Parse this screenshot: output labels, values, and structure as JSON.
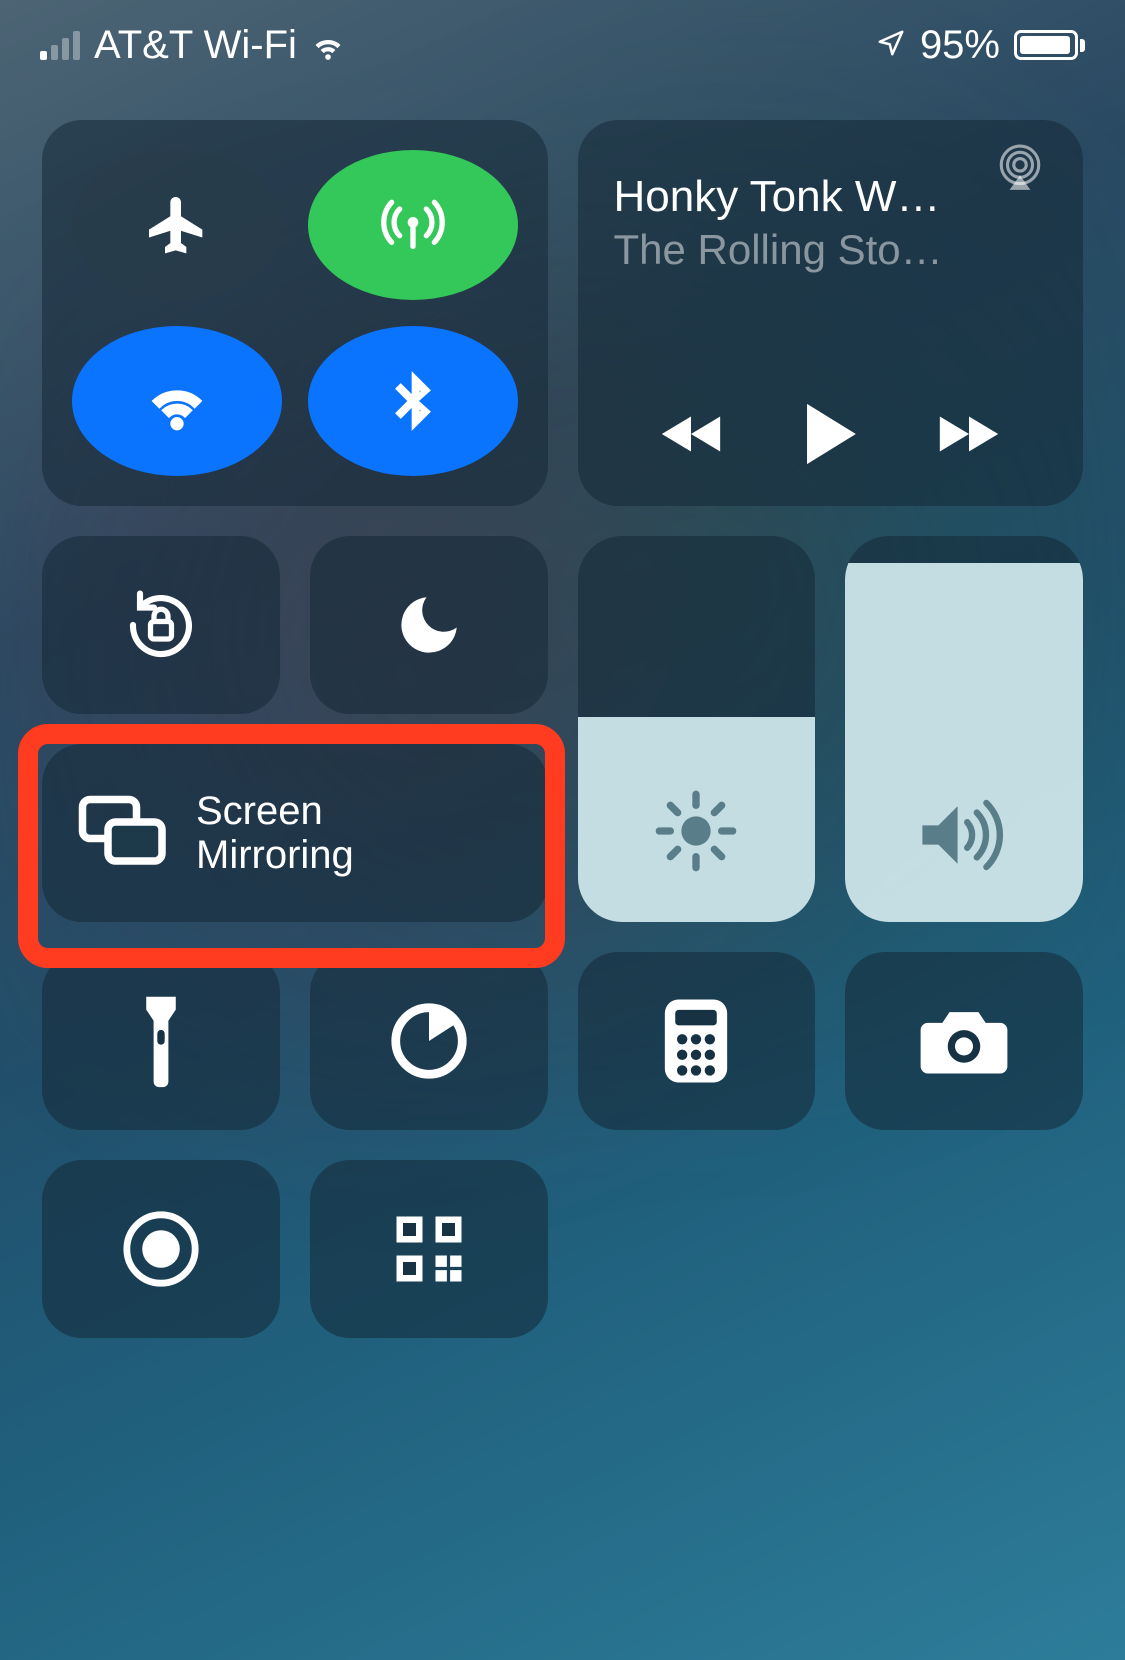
{
  "status": {
    "carrier": "AT&T Wi-Fi",
    "battery_percent": "95%"
  },
  "media": {
    "track_title": "Honky Tonk W…",
    "artist": "The Rolling Sto…"
  },
  "screen_mirroring": {
    "line1": "Screen",
    "line2": "Mirroring"
  }
}
